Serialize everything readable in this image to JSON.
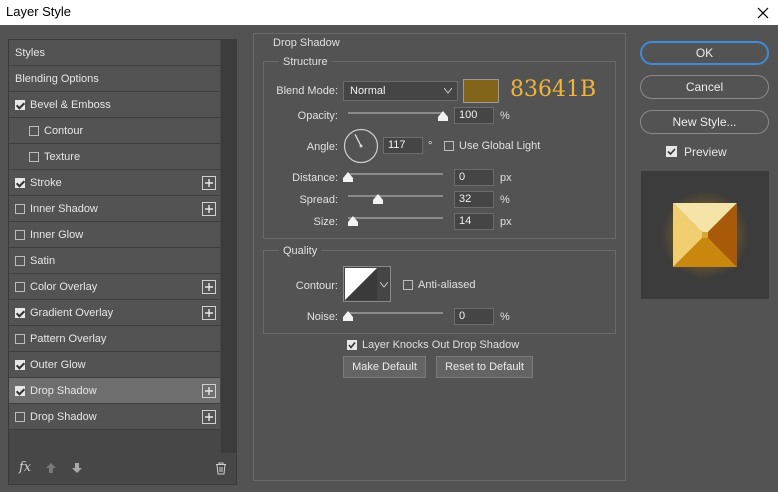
{
  "window": {
    "title": "Layer Style"
  },
  "sidebar": {
    "items": [
      {
        "label": "Styles",
        "checkbox": false,
        "checked": false,
        "indent": false,
        "plus": false,
        "selected": false
      },
      {
        "label": "Blending Options",
        "checkbox": false,
        "checked": false,
        "indent": false,
        "plus": false,
        "selected": false
      },
      {
        "label": "Bevel & Emboss",
        "checkbox": true,
        "checked": true,
        "indent": false,
        "plus": false,
        "selected": false
      },
      {
        "label": "Contour",
        "checkbox": true,
        "checked": false,
        "indent": true,
        "plus": false,
        "selected": false
      },
      {
        "label": "Texture",
        "checkbox": true,
        "checked": false,
        "indent": true,
        "plus": false,
        "selected": false
      },
      {
        "label": "Stroke",
        "checkbox": true,
        "checked": true,
        "indent": false,
        "plus": true,
        "selected": false
      },
      {
        "label": "Inner Shadow",
        "checkbox": true,
        "checked": false,
        "indent": false,
        "plus": true,
        "selected": false
      },
      {
        "label": "Inner Glow",
        "checkbox": true,
        "checked": false,
        "indent": false,
        "plus": false,
        "selected": false
      },
      {
        "label": "Satin",
        "checkbox": true,
        "checked": false,
        "indent": false,
        "plus": false,
        "selected": false
      },
      {
        "label": "Color Overlay",
        "checkbox": true,
        "checked": false,
        "indent": false,
        "plus": true,
        "selected": false
      },
      {
        "label": "Gradient Overlay",
        "checkbox": true,
        "checked": true,
        "indent": false,
        "plus": true,
        "selected": false
      },
      {
        "label": "Pattern Overlay",
        "checkbox": true,
        "checked": false,
        "indent": false,
        "plus": false,
        "selected": false
      },
      {
        "label": "Outer Glow",
        "checkbox": true,
        "checked": true,
        "indent": false,
        "plus": false,
        "selected": false
      },
      {
        "label": "Drop Shadow",
        "checkbox": true,
        "checked": true,
        "indent": false,
        "plus": true,
        "selected": true
      },
      {
        "label": "Drop Shadow",
        "checkbox": true,
        "checked": false,
        "indent": false,
        "plus": true,
        "selected": false
      }
    ],
    "footer": {
      "fx_label": "fx"
    }
  },
  "panel": {
    "title": "Drop Shadow",
    "structure": {
      "title": "Structure",
      "blend_mode_label": "Blend Mode:",
      "blend_mode_value": "Normal",
      "color_hex": "#83641B",
      "color_text": "83641B",
      "opacity_label": "Opacity:",
      "opacity_value": "100",
      "opacity_fraction": 1.0,
      "angle_label": "Angle:",
      "angle_value": "117",
      "angle_unit": "°",
      "use_global_light_label": "Use Global Light",
      "use_global_light_checked": false,
      "distance_label": "Distance:",
      "distance_value": "0",
      "distance_fraction": 0.0,
      "spread_label": "Spread:",
      "spread_value": "32",
      "spread_fraction": 0.32,
      "size_label": "Size:",
      "size_value": "14",
      "size_fraction": 0.056,
      "unit_percent": "%",
      "unit_px": "px"
    },
    "quality": {
      "title": "Quality",
      "contour_label": "Contour:",
      "anti_aliased_label": "Anti-aliased",
      "anti_aliased_checked": false,
      "noise_label": "Noise:",
      "noise_value": "0",
      "noise_fraction": 0.0,
      "unit_percent": "%"
    },
    "knocks_out_label": "Layer Knocks Out Drop Shadow",
    "knocks_out_checked": true,
    "make_default_label": "Make Default",
    "reset_default_label": "Reset to Default"
  },
  "actions": {
    "ok_label": "OK",
    "cancel_label": "Cancel",
    "new_style_label": "New Style...",
    "preview_label": "Preview",
    "preview_checked": true
  },
  "colors": {
    "accent_annotation": "#f0b53a",
    "ok_border": "#3f8cd8",
    "selected_item_bg": "#6e6e6e"
  }
}
